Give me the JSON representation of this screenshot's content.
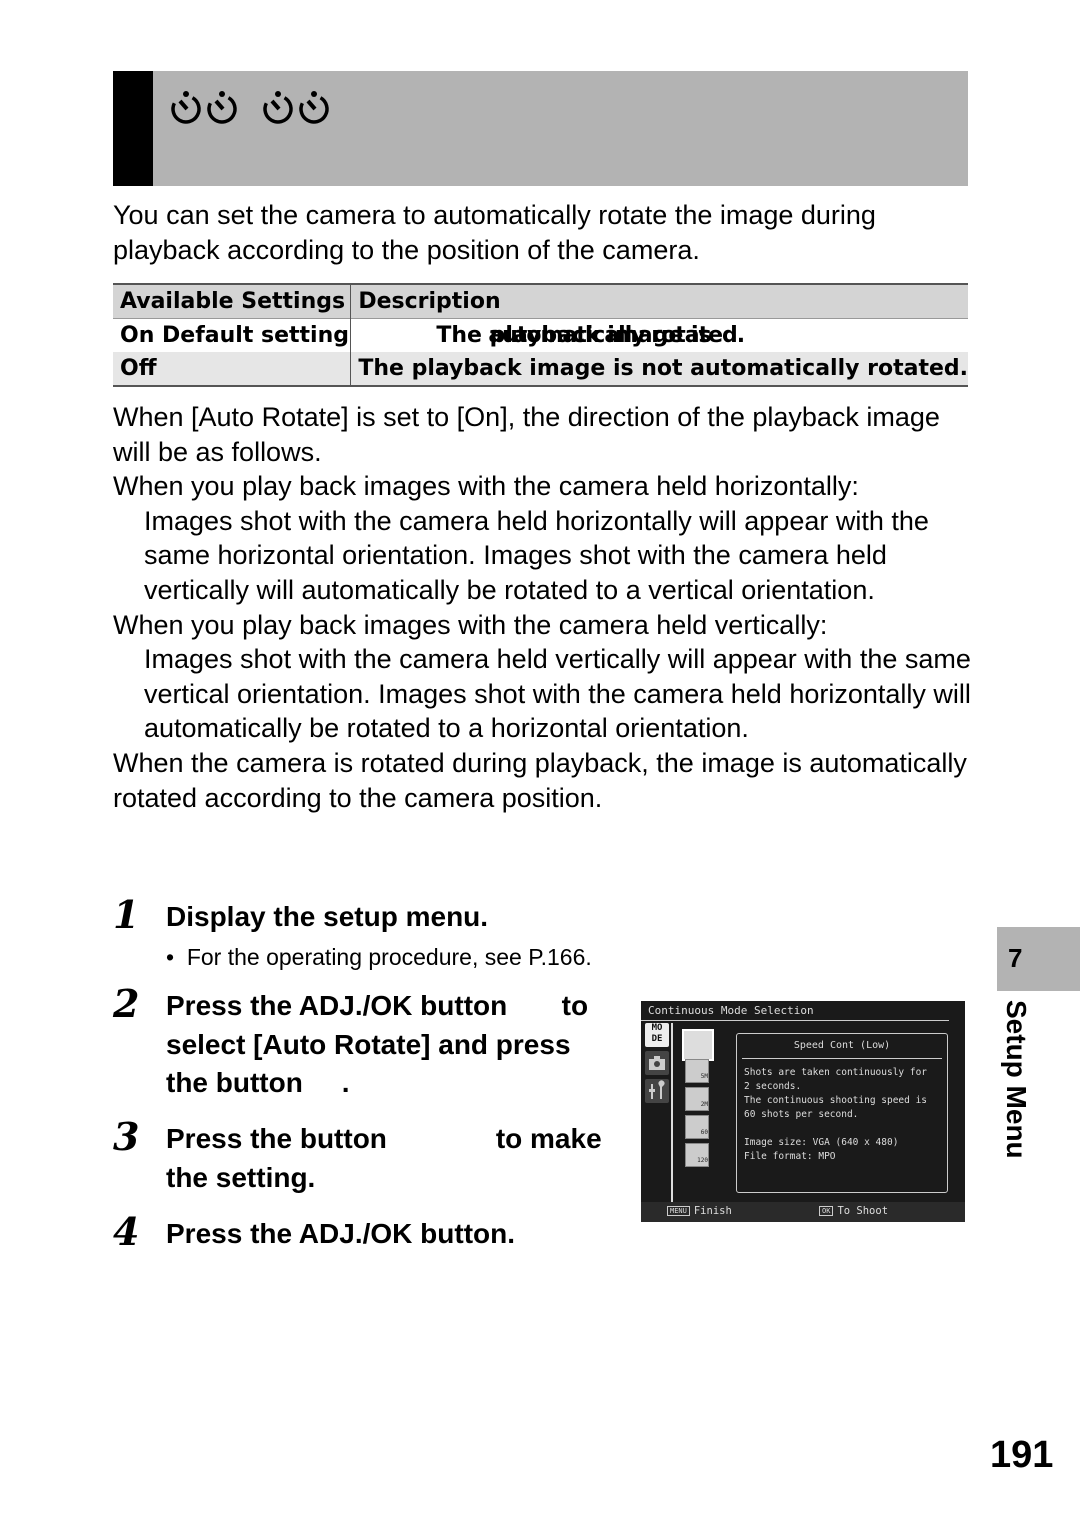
{
  "header": {
    "icon_names": [
      "self-timer-icon",
      "self-timer-icon",
      "self-timer-icon",
      "self-timer-icon"
    ]
  },
  "intro": "You can set the camera to automatically rotate the image during playback according to the position of the camera.",
  "settings_table": {
    "headers": [
      "Available Settings",
      "Description"
    ],
    "rows": [
      {
        "setting": "On Default setting",
        "description": "The playback image is automatically rotated.",
        "rendered_overlap_a": "The playback image is",
        "rendered_overlap_b": "automatically rotated."
      },
      {
        "setting": "Off",
        "description": "The playback image is not automatically rotated."
      }
    ]
  },
  "body": [
    {
      "text": "When [Auto Rotate] is set to [On], the direction of the playback image will be as follows.",
      "indent": false
    },
    {
      "text": "When you play back images with the camera held horizontally:",
      "indent": false
    },
    {
      "text": "Images shot with the camera held horizontally will appear with the same horizontal orientation. Images shot with the camera held vertically will automatically be rotated to a vertical orientation.",
      "indent": true
    },
    {
      "text": "When you play back images with the camera held vertically:",
      "indent": false
    },
    {
      "text": "Images shot with the camera held vertically will appear with the same vertical orientation. Images shot with the camera held horizontally will automatically be rotated to a horizontal orientation.",
      "indent": true
    },
    {
      "text": "When the camera is rotated during playback, the image is automatically rotated according to the camera position.",
      "indent": false
    }
  ],
  "steps": [
    {
      "num": "1",
      "text": "Display the setup menu."
    },
    {
      "num": "2",
      "text": "Press the ADJ./OK button       to select [Auto Rotate] and press the button     ."
    },
    {
      "num": "3",
      "text": "Press the button              to make the setting."
    },
    {
      "num": "4",
      "text": "Press the ADJ./OK button."
    }
  ],
  "step1_note": "For the operating procedure, see P.166.",
  "screen": {
    "title": "Continuous Mode Selection",
    "tabs": [
      "MODE",
      "camera",
      "setup"
    ],
    "active_tab_label": "MO DE",
    "modes": [
      "",
      "5M",
      "2M",
      "60",
      "120"
    ],
    "desc_title": "Speed Cont (Low)",
    "desc_body": "Shots are taken continuously for\n2 seconds.\nThe continuous shooting speed is\n60 shots per second.\n\nImage size: VGA (640 x 480)\nFile format: MPO",
    "footer_left_key": "MENU",
    "footer_left": "Finish",
    "footer_right_key": "OK",
    "footer_right": "To Shoot"
  },
  "chapter": {
    "number": "7",
    "label": "Setup Menu"
  },
  "page_number": "191"
}
